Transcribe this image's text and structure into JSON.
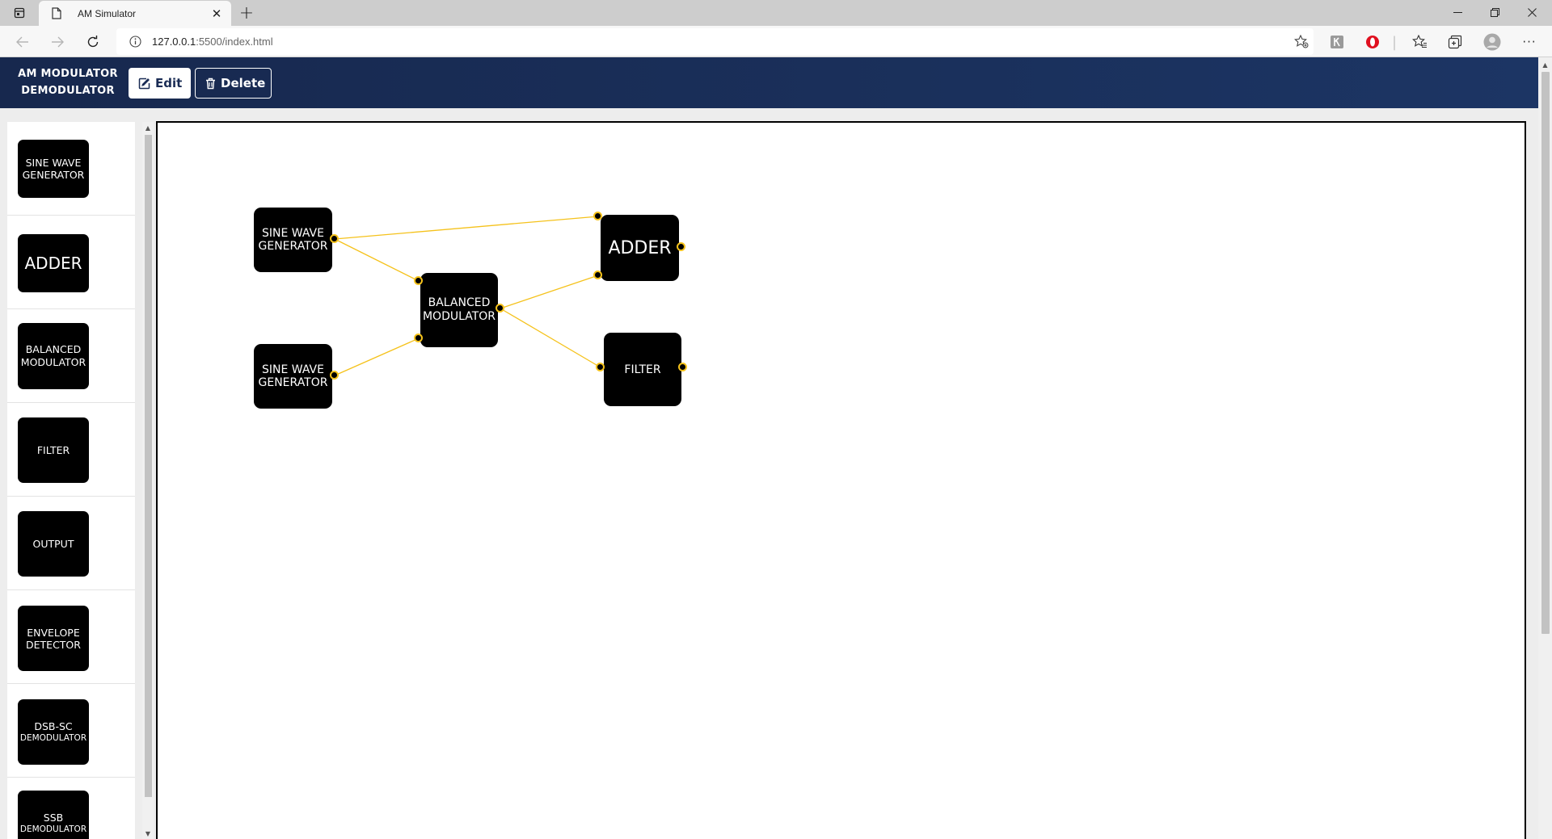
{
  "browser": {
    "tab_title": "AM Simulator",
    "url_host": "127.0.0.1",
    "url_path": ":5500/index.html",
    "new_tab_glyph": "+",
    "window_controls": [
      "minimize-icon",
      "restore-icon",
      "close-icon"
    ],
    "toolbar_icons": [
      "favorite-add-icon",
      "extension-icon",
      "opera-icon",
      "favorites-icon",
      "collections-icon",
      "profile-icon",
      "more-icon"
    ]
  },
  "header": {
    "brand_line1": "AM MODULATOR",
    "brand_line2": "DEMODULATOR",
    "edit_label": "Edit",
    "delete_label": "Delete",
    "background_color": "#17284e"
  },
  "palette": {
    "items": [
      {
        "line1": "SINE WAVE",
        "line2": "GENERATOR"
      },
      {
        "line1": "ADDER",
        "line2": ""
      },
      {
        "line1": "BALANCED",
        "line2": "MODULATOR"
      },
      {
        "line1": "FILTER",
        "line2": ""
      },
      {
        "line1": "OUTPUT",
        "line2": ""
      },
      {
        "line1": "ENVELOPE",
        "line2": "DETECTOR"
      },
      {
        "line1": "DSB-SC",
        "line2": "DEMODULATOR"
      },
      {
        "line1": "SSB",
        "line2": "DEMODULATOR"
      }
    ]
  },
  "canvas": {
    "nodes": [
      {
        "id": "sine1",
        "line1": "SINE WAVE",
        "line2": "GENERATOR"
      },
      {
        "id": "sine2",
        "line1": "SINE WAVE",
        "line2": "GENERATOR"
      },
      {
        "id": "balmod",
        "line1": "BALANCED",
        "line2": "MODULATOR"
      },
      {
        "id": "adder",
        "line1": "ADDER",
        "line2": ""
      },
      {
        "id": "filter",
        "line1": "FILTER",
        "line2": ""
      }
    ],
    "connections": [
      {
        "from": "sine1.out",
        "to": "adder.in1"
      },
      {
        "from": "sine1.out",
        "to": "balmod.in1"
      },
      {
        "from": "sine2.out",
        "to": "balmod.in2"
      },
      {
        "from": "balmod.out",
        "to": "adder.in2"
      },
      {
        "from": "balmod.out",
        "to": "filter.in"
      }
    ],
    "wire_color": "#f5c21b",
    "port_color": "#f5c21b"
  }
}
